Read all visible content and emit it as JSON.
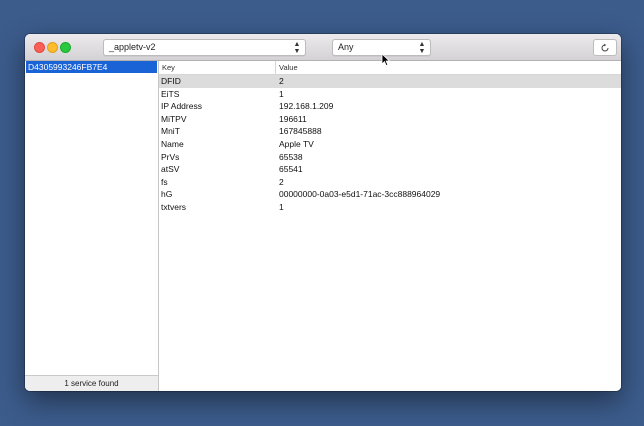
{
  "window": {
    "toolbar": {
      "service_type": "_appletv-v2",
      "interface": "Any"
    },
    "sidebar": {
      "items": [
        {
          "label": "D4305993246FB7E4",
          "selected": true
        }
      ],
      "footer": "1 service found"
    },
    "table": {
      "columns": {
        "key": "Key",
        "value": "Value"
      },
      "rows": [
        {
          "key": "DFID",
          "value": "2"
        },
        {
          "key": "EiTS",
          "value": "1"
        },
        {
          "key": "IP Address",
          "value": "192.168.1.209"
        },
        {
          "key": "MiTPV",
          "value": "196611"
        },
        {
          "key": "MniT",
          "value": "167845888"
        },
        {
          "key": "Name",
          "value": "Apple TV"
        },
        {
          "key": "PrVs",
          "value": "65538"
        },
        {
          "key": "atSV",
          "value": "65541"
        },
        {
          "key": "fs",
          "value": "2"
        },
        {
          "key": "hG",
          "value": "00000000-0a03-e5d1-71ac-3cc888964029"
        },
        {
          "key": "txtvers",
          "value": "1"
        }
      ],
      "selected_row": 0
    }
  },
  "colors": {
    "desktop": "#3c5c8c",
    "selection": "#1a63d6",
    "row_highlight": "#dcdcdc"
  },
  "icons": {
    "close": "close-icon",
    "minimize": "minimize-icon",
    "zoom": "zoom-icon",
    "refresh": "refresh-icon",
    "cursor": "mouse-cursor-icon"
  }
}
